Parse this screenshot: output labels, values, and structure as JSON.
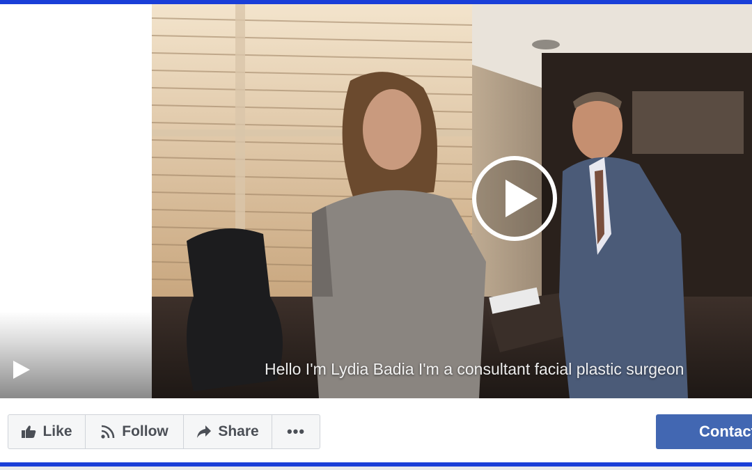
{
  "video": {
    "caption": "Hello I'm Lydia Badia I'm a consultant facial plastic surgeon"
  },
  "actions": {
    "like_label": "Like",
    "follow_label": "Follow",
    "share_label": "Share",
    "more_label": "•••",
    "contact_label": "Contact"
  },
  "icons": {
    "like": "thumbs-up-icon",
    "follow": "rss-icon",
    "share": "share-arrow-icon",
    "play": "play-icon"
  },
  "colors": {
    "frame": "#1a3fd8",
    "contact_button": "#4267b2",
    "action_text": "#4b4f56"
  }
}
